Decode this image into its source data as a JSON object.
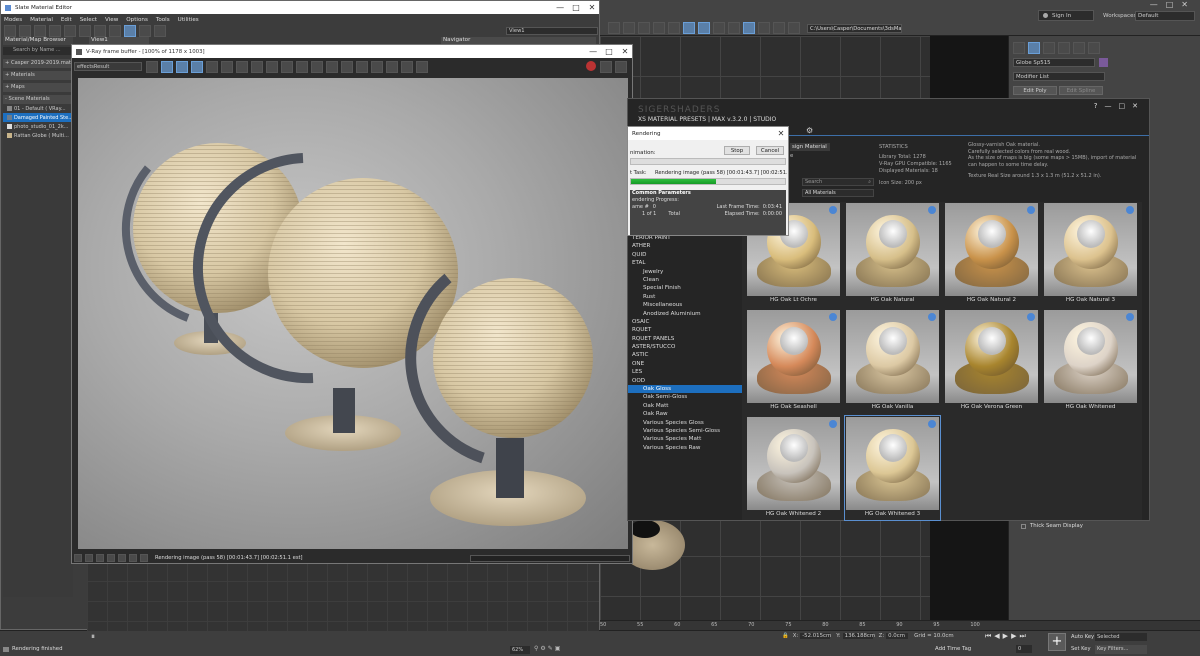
{
  "max": {
    "path": "C:\\Users\\Casper\\Documents\\3dsMax",
    "sign_in": "Sign In",
    "workspaces_label": "Workspaces:",
    "workspaces_value": "Default",
    "view_dropdown": "View1",
    "object_name": "Globe Sp515",
    "modifier_list": "Modifier List",
    "edit_poly": "Edit Poly",
    "edit_spline": "Edit Spline",
    "thick_seam": "Thick Seam Display",
    "status_text": "Rendering finished",
    "zoom": "62%",
    "ticks": [
      "50",
      "55",
      "60",
      "65",
      "70",
      "75",
      "80",
      "85",
      "90",
      "95",
      "100"
    ],
    "coord_x_label": "X:",
    "coord_x": "-52.015cm",
    "coord_y_label": "Y:",
    "coord_y": "136.188cm",
    "coord_z_label": "Z:",
    "coord_z": "0.0cm",
    "grid": "Grid = 10.0cm",
    "add_time_tag": "Add Time Tag",
    "auto_key": "Auto Key",
    "set_key": "Set Key",
    "selected": "Selected",
    "key_filters": "Key Filters...",
    "frame_num": "0"
  },
  "slate": {
    "title": "Slate Material Editor",
    "menu": [
      "Modes",
      "Material",
      "Edit",
      "Select",
      "View",
      "Options",
      "Tools",
      "Utilities"
    ],
    "browser_header": "Material/Map Browser",
    "search_placeholder": "Search by Name ...",
    "sections": [
      "+ Casper 2019-2019.mat",
      "+ Materials",
      "+ Maps",
      "- Scene Materials"
    ],
    "scene_items": [
      "01 - Default  ( VRay...",
      "Damaged Painted Ste...",
      "photo_studio_01_2k...",
      "Rattan Globe  ( Multi..."
    ],
    "view_tab": "View1",
    "navigator": "Navigator"
  },
  "vfb": {
    "title": "V-Ray frame buffer - [100% of 1178 x 1003]",
    "channel": "effectsResult",
    "status": "Rendering image (pass 58) [00:01:43.7] [00:02:51.1 est]"
  },
  "rendering": {
    "title": "Rendering",
    "animation_label": "nimation:",
    "stop": "Stop",
    "cancel": "Cancel",
    "task_label": "t Task:",
    "task_value": "Rendering image (pass 58) [00:01:43.7] [00:02:51.1 est]",
    "common_params": "Common Parameters",
    "progress_label": "endering Progress:",
    "frame_label": "ame #",
    "frame_value": "0",
    "of_value": "1 of  1",
    "total": "Total",
    "last_frame_label": "Last Frame Time:",
    "last_frame_value": "0:03:41",
    "elapsed_label": "Elapsed Time:",
    "elapsed_value": "0:00:00",
    "progress_pct": 0.55
  },
  "siger": {
    "brand": "SIGERSHADERS",
    "title": "XS MATERIAL PRESETS | MAX v.3.2.0 | STUDIO",
    "tab": "sign Material",
    "tab_sub": "e",
    "search_placeholder": "Search",
    "filter": "All Materials",
    "stats_title": "STATISTICS",
    "stats": [
      "Library Total: 1278",
      "V-Ray GPU Compatible: 1165",
      "Displayed Materials: 18"
    ],
    "icon_size": "Icon Size: 200 px",
    "description": [
      "Glossy-varnish Oak material.",
      "Carefully selected colors from real wood.",
      "As the size of maps is big (some maps > 15MB), import of material can happen to some time delay."
    ],
    "texture_size": "Texture Real Size around 1.3 x 1.3 m (51.2 x 51.2 in).",
    "categories": [
      {
        "label": "TERIOR PAINT",
        "sub": false,
        "sel": false
      },
      {
        "label": "ATHER",
        "sub": false,
        "sel": false
      },
      {
        "label": "QUID",
        "sub": false,
        "sel": false
      },
      {
        "label": "ETAL",
        "sub": false,
        "sel": false
      },
      {
        "label": "Jewelry",
        "sub": true,
        "sel": false
      },
      {
        "label": "Clean",
        "sub": true,
        "sel": false
      },
      {
        "label": "Special Finish",
        "sub": true,
        "sel": false
      },
      {
        "label": "Rust",
        "sub": true,
        "sel": false
      },
      {
        "label": "Miscellaneous",
        "sub": true,
        "sel": false
      },
      {
        "label": "Anodized Aluminium",
        "sub": true,
        "sel": false
      },
      {
        "label": "OSAIC",
        "sub": false,
        "sel": false
      },
      {
        "label": "RQUET",
        "sub": false,
        "sel": false
      },
      {
        "label": "RQUET PANELS",
        "sub": false,
        "sel": false
      },
      {
        "label": "ASTER/STUCCO",
        "sub": false,
        "sel": false
      },
      {
        "label": "ASTIC",
        "sub": false,
        "sel": false
      },
      {
        "label": "ONE",
        "sub": false,
        "sel": false
      },
      {
        "label": "LES",
        "sub": false,
        "sel": false
      },
      {
        "label": "OOD",
        "sub": false,
        "sel": false
      },
      {
        "label": "Oak Gloss",
        "sub": true,
        "sel": true
      },
      {
        "label": "Oak Semi-Gloss",
        "sub": true,
        "sel": false
      },
      {
        "label": "Oak Matt",
        "sub": true,
        "sel": false
      },
      {
        "label": "Oak Raw",
        "sub": true,
        "sel": false
      },
      {
        "label": "Various Species Gloss",
        "sub": true,
        "sel": false
      },
      {
        "label": "Various Species Semi-Gloss",
        "sub": true,
        "sel": false
      },
      {
        "label": "Various Species Matt",
        "sub": true,
        "sel": false
      },
      {
        "label": "Various Species Raw",
        "sub": true,
        "sel": false
      }
    ],
    "materials": [
      {
        "name": "HG Oak Lt Ochre",
        "color": "#d9bd7c"
      },
      {
        "name": "HG Oak Natural",
        "color": "#d6bf8a"
      },
      {
        "name": "HG Oak Natural 2",
        "color": "#c9924a"
      },
      {
        "name": "HG Oak Natural 3",
        "color": "#dcc28e"
      },
      {
        "name": "HG Oak Seashell",
        "color": "#d5895a"
      },
      {
        "name": "HG Oak Vanilla",
        "color": "#dcc9a4"
      },
      {
        "name": "HG Oak Verona Green",
        "color": "#a8852e"
      },
      {
        "name": "HG Oak Whitened",
        "color": "#ddd3c8"
      },
      {
        "name": "HG Oak Whitened 2",
        "color": "#c8c3bc"
      },
      {
        "name": "HG Oak Whitened 3",
        "color": "#dcc795"
      }
    ]
  }
}
